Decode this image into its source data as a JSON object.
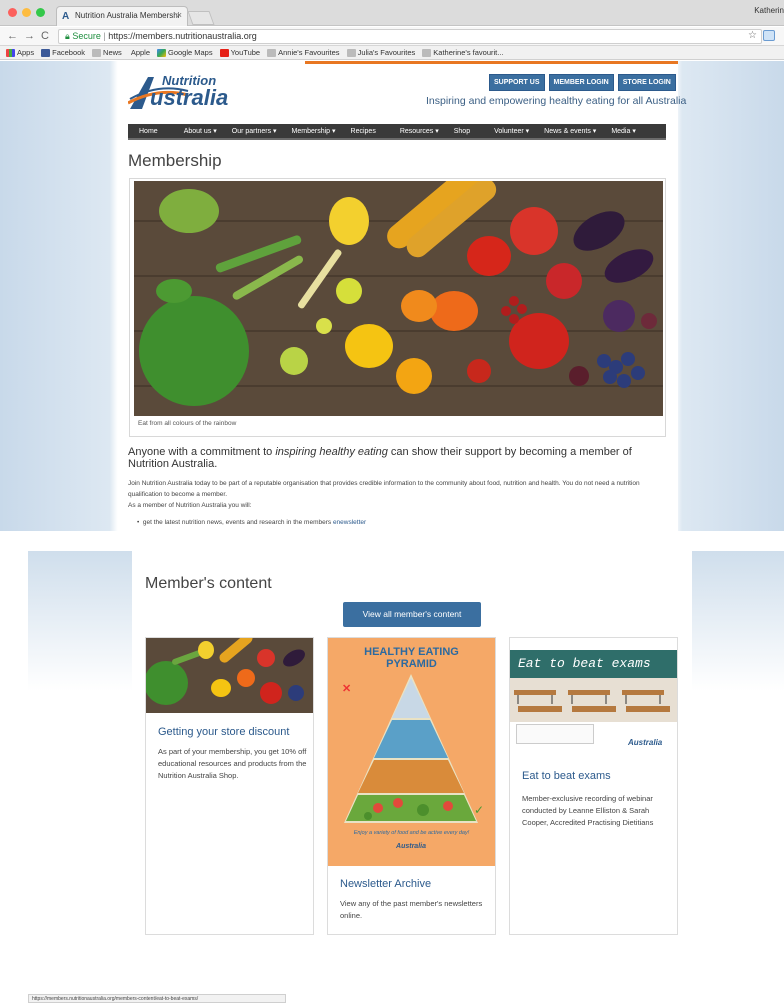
{
  "browser": {
    "tab_title": "Nutrition Australia Membershi",
    "user_name": "Katherin",
    "url_secure": "Secure",
    "url": "https://members.nutritionaustralia.org",
    "bookmarks": [
      "Apps",
      "Facebook",
      "News",
      "Apple",
      "Google Maps",
      "YouTube",
      "Annie's Favourites",
      "Julia's Favourites",
      "Katherine's favourit..."
    ],
    "status_url": "https://members.nutritionaustralia.org/members-content/eat-to-beat-exams/"
  },
  "header": {
    "logo_top": "Nutrition",
    "logo_bottom": "ustralia",
    "buttons": [
      "SUPPORT US",
      "MEMBER LOGIN",
      "STORE LOGIN"
    ],
    "tagline": "Inspiring and empowering healthy eating for all Australia"
  },
  "nav": {
    "items": [
      "Home",
      "About us ▾",
      "Our partners ▾",
      "Membership ▾",
      "Recipes",
      "Resources ▾",
      "Shop",
      "Volunteer ▾",
      "News & events ▾",
      "Media ▾"
    ]
  },
  "main": {
    "title": "Membership",
    "caption": "Eat from all colours of the rainbow",
    "intro_pre": "Anyone with a commitment to ",
    "intro_em": "inspiring healthy eating",
    "intro_post": " can show their support by becoming a member of Nutrition Australia.",
    "paragraph1": "Join Nutrition Australia today to be part of a reputable organisation that provides credible information to the community about food, nutrition and health. You do not need a nutrition qualification to become a member.",
    "paragraph2": "As a member of Nutrition Australia you will:",
    "bullet_pre": "get the latest nutrition news, events and research in the members ",
    "bullet_link": "enewsletter"
  },
  "members_content": {
    "title": "Member's content",
    "view_all": "View all member's content",
    "cards": [
      {
        "title": "Getting your store discount",
        "text": "As part of your membership, you get 10% off educational resources and products from the Nutrition Australia Shop."
      },
      {
        "title": "Newsletter Archive",
        "text": "View any of the past member's newsletters online.",
        "poster_title": "HEALTHY EATING PYRAMID",
        "poster_footer": "Enjoy a variety of food and be active every day!"
      },
      {
        "title": "Eat to beat exams",
        "text": "Member-exclusive recording of webinar conducted by Leanne Elliston & Sarah Cooper, Accredited Practising Dietitians",
        "banner_text": "Eat to beat exams"
      }
    ]
  }
}
